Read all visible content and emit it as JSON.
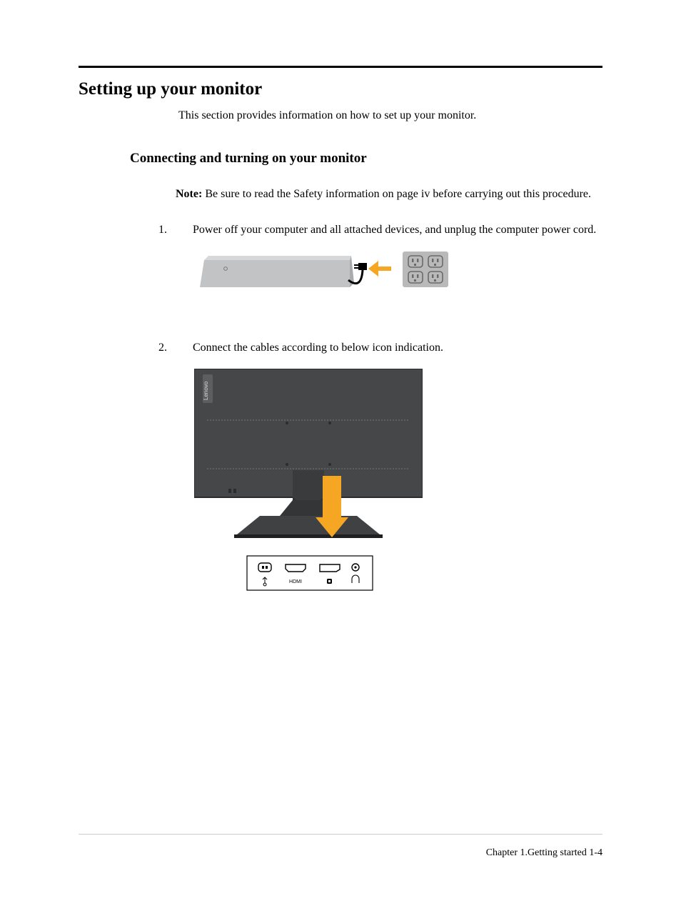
{
  "heading": "Setting up your monitor",
  "intro": "This section provides information on how to set up your monitor.",
  "subheading": "Connecting and turning on your monitor",
  "note": {
    "label": "Note:",
    "text": " Be sure to read the Safety information on page iv before carrying out this procedure."
  },
  "steps": {
    "s1_num": "1.",
    "s1_text": "Power off your computer and all attached devices, and unplug the computer power cord.",
    "s2_num": "2.",
    "s2_text": "Connect the cables according to below icon indication."
  },
  "figure2": {
    "brand": "Lenovo",
    "port_hdmi": "HDMI"
  },
  "footer": "Chapter 1.Getting started  1-4"
}
